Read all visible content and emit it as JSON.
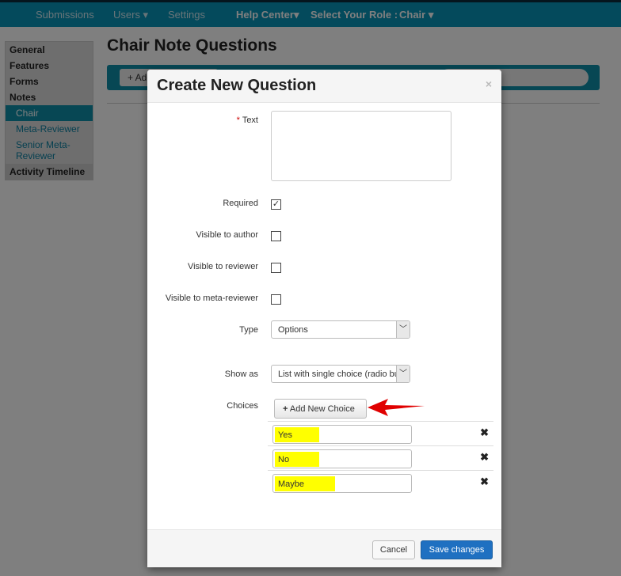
{
  "nav": {
    "items": [
      "Submissions",
      "Users ▾",
      "Settings"
    ],
    "help": "Help Center▾",
    "role_label": "Select Your Role :",
    "role": "Chair ▾"
  },
  "sidebar": {
    "items": [
      "General",
      "Features",
      "Forms",
      "Notes"
    ],
    "subitems": [
      "Chair",
      "Meta-Reviewer",
      "Senior Meta-Reviewer"
    ],
    "last": "Activity Timeline"
  },
  "page": {
    "title": "Chair Note Questions",
    "add_button": "+ Add"
  },
  "modal": {
    "title": "Create New Question",
    "close": "×",
    "text_label": "Text",
    "required_mark": "*",
    "checks": [
      {
        "label": "Required",
        "checked": true
      },
      {
        "label": "Visible to author",
        "checked": false
      },
      {
        "label": "Visible to reviewer",
        "checked": false
      },
      {
        "label": "Visible to meta-reviewer",
        "checked": false
      }
    ],
    "type_label": "Type",
    "type_value": "Options",
    "show_label": "Show as",
    "show_value": "List with single choice (radio buttons)",
    "choices_label": "Choices",
    "add_choice": "Add New Choice",
    "choices": [
      "Yes",
      "No",
      "Maybe"
    ],
    "cancel": "Cancel",
    "save": "Save changes"
  },
  "colors": {
    "navbar": "#0994b8",
    "highlight": "#ffff00",
    "primary": "#1f70c1",
    "arrow": "#e00000"
  }
}
